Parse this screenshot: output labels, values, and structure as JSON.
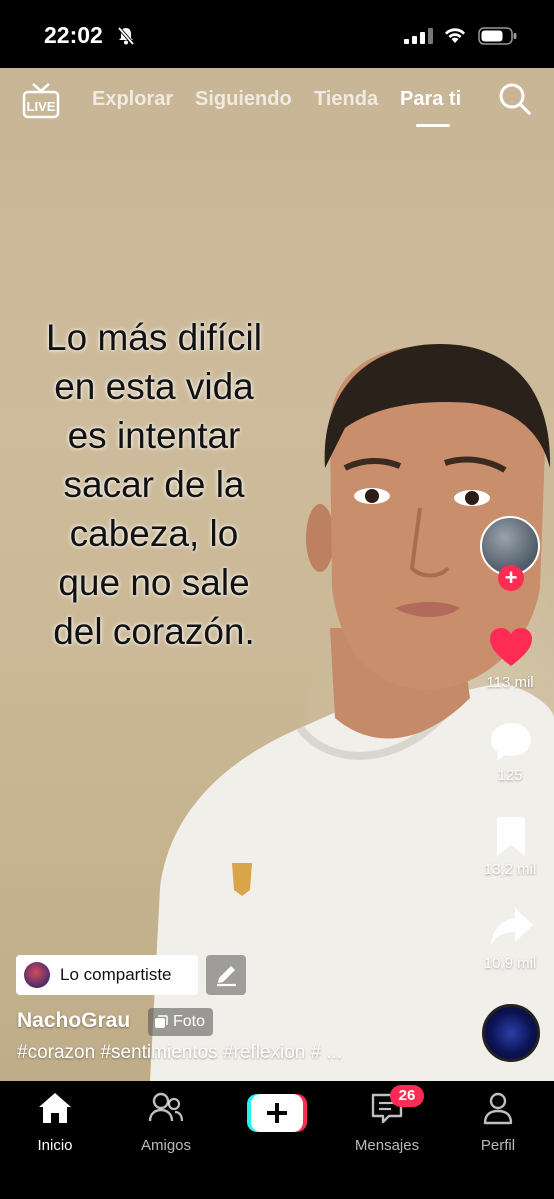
{
  "status_bar": {
    "time": "22:02"
  },
  "top_nav": {
    "live_label": "LIVE",
    "tabs": [
      {
        "label": "Explorar",
        "active": false
      },
      {
        "label": "Siguiendo",
        "active": false
      },
      {
        "label": "Tienda",
        "active": false
      },
      {
        "label": "Para ti",
        "active": true
      }
    ]
  },
  "video": {
    "caption_lines": [
      "Lo más difícil",
      "en esta vida",
      "es intentar",
      "sacar de la",
      "cabeza, lo",
      "que no sale",
      "del corazón."
    ],
    "shared_label": "Lo compartiste",
    "author": "NachoGrau",
    "post_type": "Foto",
    "hashtags": "#corazon #sentimientos #reflexion # ..."
  },
  "actions": {
    "likes": "113 mil",
    "comments": "125",
    "saves": "13,2 mil",
    "shares": "10,9 mil"
  },
  "bottom_nav": {
    "home": "Inicio",
    "friends": "Amigos",
    "inbox": "Mensajes",
    "inbox_badge": "26",
    "profile": "Perfil"
  },
  "colors": {
    "accent": "#fe2c55",
    "background": "#000000"
  }
}
